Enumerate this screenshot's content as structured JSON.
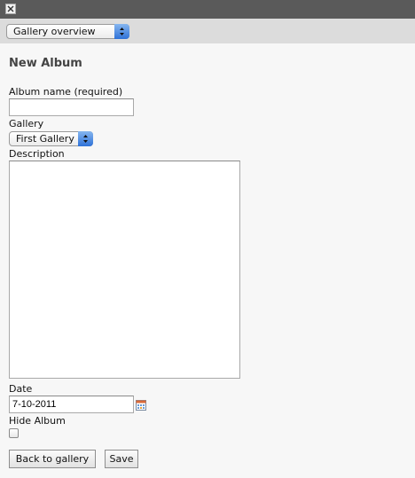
{
  "window": {
    "close_icon": "close-icon"
  },
  "toolbar": {
    "view_select_value": "Gallery overview"
  },
  "form": {
    "title": "New Album",
    "album_name": {
      "label": "Album name (required)",
      "value": ""
    },
    "gallery": {
      "label": "Gallery",
      "value": "First Gallery"
    },
    "description": {
      "label": "Description",
      "value": ""
    },
    "date": {
      "label": "Date",
      "value": "7-10-2011",
      "picker_icon": "calendar-icon"
    },
    "hide_album": {
      "label": "Hide Album",
      "checked": false
    }
  },
  "buttons": {
    "back": "Back to gallery",
    "save": "Save"
  },
  "colors": {
    "select_arrow_accent": "#2f72d8",
    "titlebar": "#5a5a5a",
    "toolbar": "#dcdcdc"
  }
}
